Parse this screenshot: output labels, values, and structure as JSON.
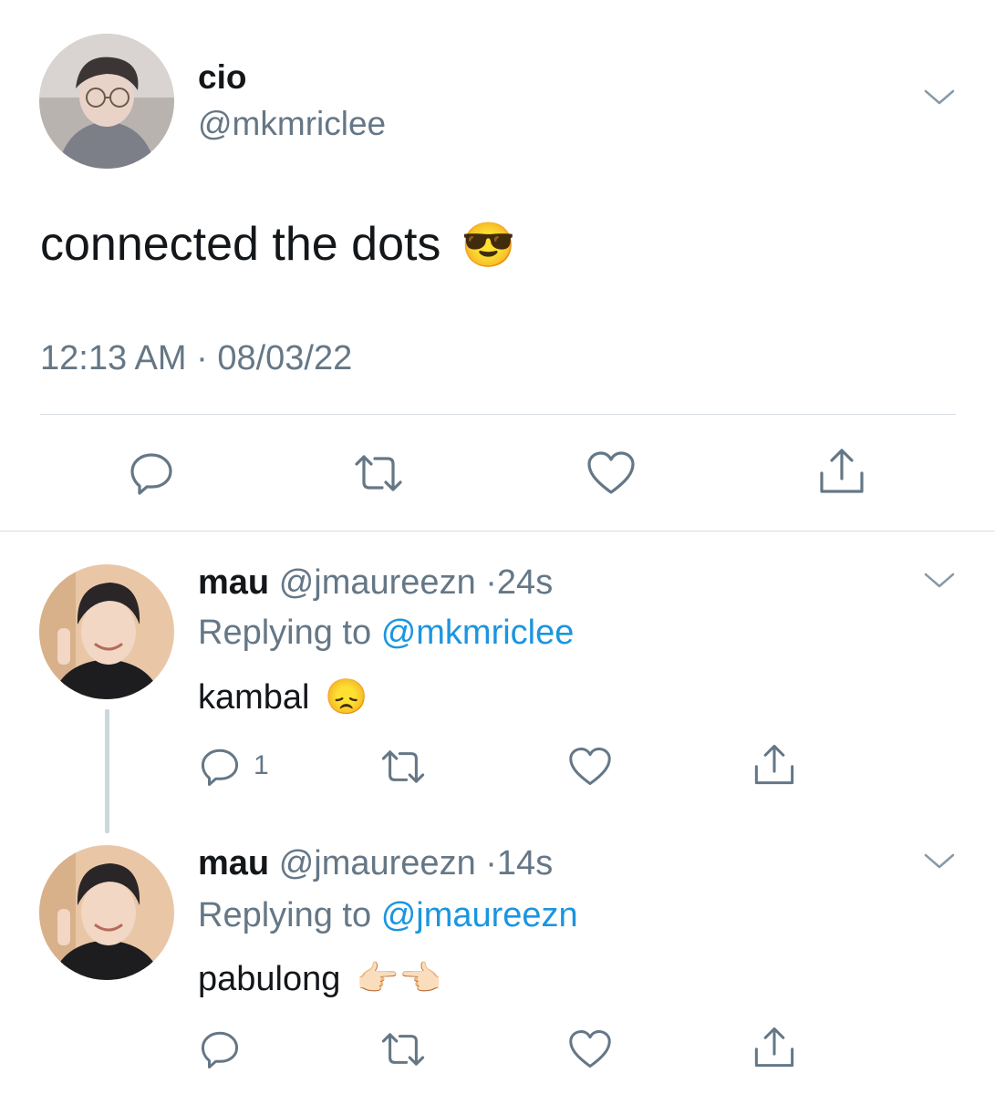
{
  "main_tweet": {
    "display_name": "cio",
    "handle": "@mkmriclee",
    "text": "connected the dots",
    "emoji": "😎",
    "timestamp": "12:13 AM · 08/03/22",
    "avatar_icon": "avatar-person-glasses"
  },
  "replies": [
    {
      "display_name": "mau",
      "handle": "@jmaureezn",
      "separator": "·",
      "time": "24s",
      "replying_prefix": "Replying to",
      "replying_to": "@mkmriclee",
      "text": "kambal",
      "emoji": "😞",
      "reply_count": "1"
    },
    {
      "display_name": "mau",
      "handle": "@jmaureezn",
      "separator": "·",
      "time": "14s",
      "replying_prefix": "Replying to",
      "replying_to": "@jmaureezn",
      "text": "pabulong",
      "emoji": "👉🏻👈🏻",
      "reply_count": ""
    }
  ],
  "colors": {
    "text": "#14171a",
    "secondary": "#657786",
    "link": "#1b95e0",
    "divider": "#d7dde2",
    "thread_line": "#ccd6dd"
  },
  "icons": {
    "reply": "reply-icon",
    "retweet": "retweet-icon",
    "like": "heart-icon",
    "share": "share-icon",
    "menu": "chevron-down-icon"
  }
}
